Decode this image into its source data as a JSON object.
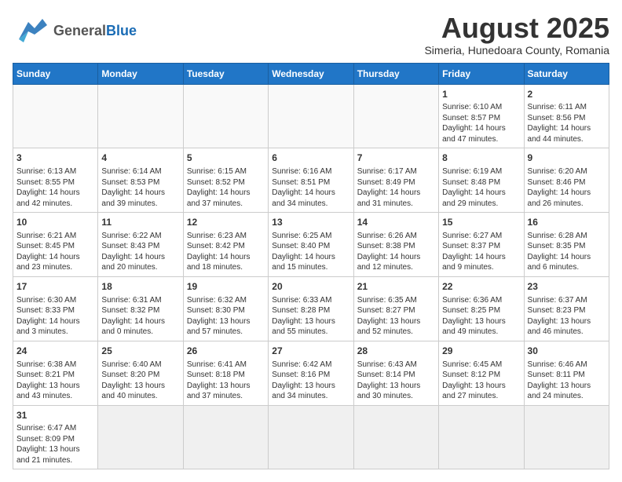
{
  "header": {
    "logo_general": "General",
    "logo_blue": "Blue",
    "month_title": "August 2025",
    "subtitle": "Simeria, Hunedoara County, Romania"
  },
  "weekdays": [
    "Sunday",
    "Monday",
    "Tuesday",
    "Wednesday",
    "Thursday",
    "Friday",
    "Saturday"
  ],
  "weeks": [
    [
      {
        "day": "",
        "info": ""
      },
      {
        "day": "",
        "info": ""
      },
      {
        "day": "",
        "info": ""
      },
      {
        "day": "",
        "info": ""
      },
      {
        "day": "",
        "info": ""
      },
      {
        "day": "1",
        "info": "Sunrise: 6:10 AM\nSunset: 8:57 PM\nDaylight: 14 hours and 47 minutes."
      },
      {
        "day": "2",
        "info": "Sunrise: 6:11 AM\nSunset: 8:56 PM\nDaylight: 14 hours and 44 minutes."
      }
    ],
    [
      {
        "day": "3",
        "info": "Sunrise: 6:13 AM\nSunset: 8:55 PM\nDaylight: 14 hours and 42 minutes."
      },
      {
        "day": "4",
        "info": "Sunrise: 6:14 AM\nSunset: 8:53 PM\nDaylight: 14 hours and 39 minutes."
      },
      {
        "day": "5",
        "info": "Sunrise: 6:15 AM\nSunset: 8:52 PM\nDaylight: 14 hours and 37 minutes."
      },
      {
        "day": "6",
        "info": "Sunrise: 6:16 AM\nSunset: 8:51 PM\nDaylight: 14 hours and 34 minutes."
      },
      {
        "day": "7",
        "info": "Sunrise: 6:17 AM\nSunset: 8:49 PM\nDaylight: 14 hours and 31 minutes."
      },
      {
        "day": "8",
        "info": "Sunrise: 6:19 AM\nSunset: 8:48 PM\nDaylight: 14 hours and 29 minutes."
      },
      {
        "day": "9",
        "info": "Sunrise: 6:20 AM\nSunset: 8:46 PM\nDaylight: 14 hours and 26 minutes."
      }
    ],
    [
      {
        "day": "10",
        "info": "Sunrise: 6:21 AM\nSunset: 8:45 PM\nDaylight: 14 hours and 23 minutes."
      },
      {
        "day": "11",
        "info": "Sunrise: 6:22 AM\nSunset: 8:43 PM\nDaylight: 14 hours and 20 minutes."
      },
      {
        "day": "12",
        "info": "Sunrise: 6:23 AM\nSunset: 8:42 PM\nDaylight: 14 hours and 18 minutes."
      },
      {
        "day": "13",
        "info": "Sunrise: 6:25 AM\nSunset: 8:40 PM\nDaylight: 14 hours and 15 minutes."
      },
      {
        "day": "14",
        "info": "Sunrise: 6:26 AM\nSunset: 8:38 PM\nDaylight: 14 hours and 12 minutes."
      },
      {
        "day": "15",
        "info": "Sunrise: 6:27 AM\nSunset: 8:37 PM\nDaylight: 14 hours and 9 minutes."
      },
      {
        "day": "16",
        "info": "Sunrise: 6:28 AM\nSunset: 8:35 PM\nDaylight: 14 hours and 6 minutes."
      }
    ],
    [
      {
        "day": "17",
        "info": "Sunrise: 6:30 AM\nSunset: 8:33 PM\nDaylight: 14 hours and 3 minutes."
      },
      {
        "day": "18",
        "info": "Sunrise: 6:31 AM\nSunset: 8:32 PM\nDaylight: 14 hours and 0 minutes."
      },
      {
        "day": "19",
        "info": "Sunrise: 6:32 AM\nSunset: 8:30 PM\nDaylight: 13 hours and 57 minutes."
      },
      {
        "day": "20",
        "info": "Sunrise: 6:33 AM\nSunset: 8:28 PM\nDaylight: 13 hours and 55 minutes."
      },
      {
        "day": "21",
        "info": "Sunrise: 6:35 AM\nSunset: 8:27 PM\nDaylight: 13 hours and 52 minutes."
      },
      {
        "day": "22",
        "info": "Sunrise: 6:36 AM\nSunset: 8:25 PM\nDaylight: 13 hours and 49 minutes."
      },
      {
        "day": "23",
        "info": "Sunrise: 6:37 AM\nSunset: 8:23 PM\nDaylight: 13 hours and 46 minutes."
      }
    ],
    [
      {
        "day": "24",
        "info": "Sunrise: 6:38 AM\nSunset: 8:21 PM\nDaylight: 13 hours and 43 minutes."
      },
      {
        "day": "25",
        "info": "Sunrise: 6:40 AM\nSunset: 8:20 PM\nDaylight: 13 hours and 40 minutes."
      },
      {
        "day": "26",
        "info": "Sunrise: 6:41 AM\nSunset: 8:18 PM\nDaylight: 13 hours and 37 minutes."
      },
      {
        "day": "27",
        "info": "Sunrise: 6:42 AM\nSunset: 8:16 PM\nDaylight: 13 hours and 34 minutes."
      },
      {
        "day": "28",
        "info": "Sunrise: 6:43 AM\nSunset: 8:14 PM\nDaylight: 13 hours and 30 minutes."
      },
      {
        "day": "29",
        "info": "Sunrise: 6:45 AM\nSunset: 8:12 PM\nDaylight: 13 hours and 27 minutes."
      },
      {
        "day": "30",
        "info": "Sunrise: 6:46 AM\nSunset: 8:11 PM\nDaylight: 13 hours and 24 minutes."
      }
    ],
    [
      {
        "day": "31",
        "info": "Sunrise: 6:47 AM\nSunset: 8:09 PM\nDaylight: 13 hours and 21 minutes."
      },
      {
        "day": "",
        "info": ""
      },
      {
        "day": "",
        "info": ""
      },
      {
        "day": "",
        "info": ""
      },
      {
        "day": "",
        "info": ""
      },
      {
        "day": "",
        "info": ""
      },
      {
        "day": "",
        "info": ""
      }
    ]
  ]
}
